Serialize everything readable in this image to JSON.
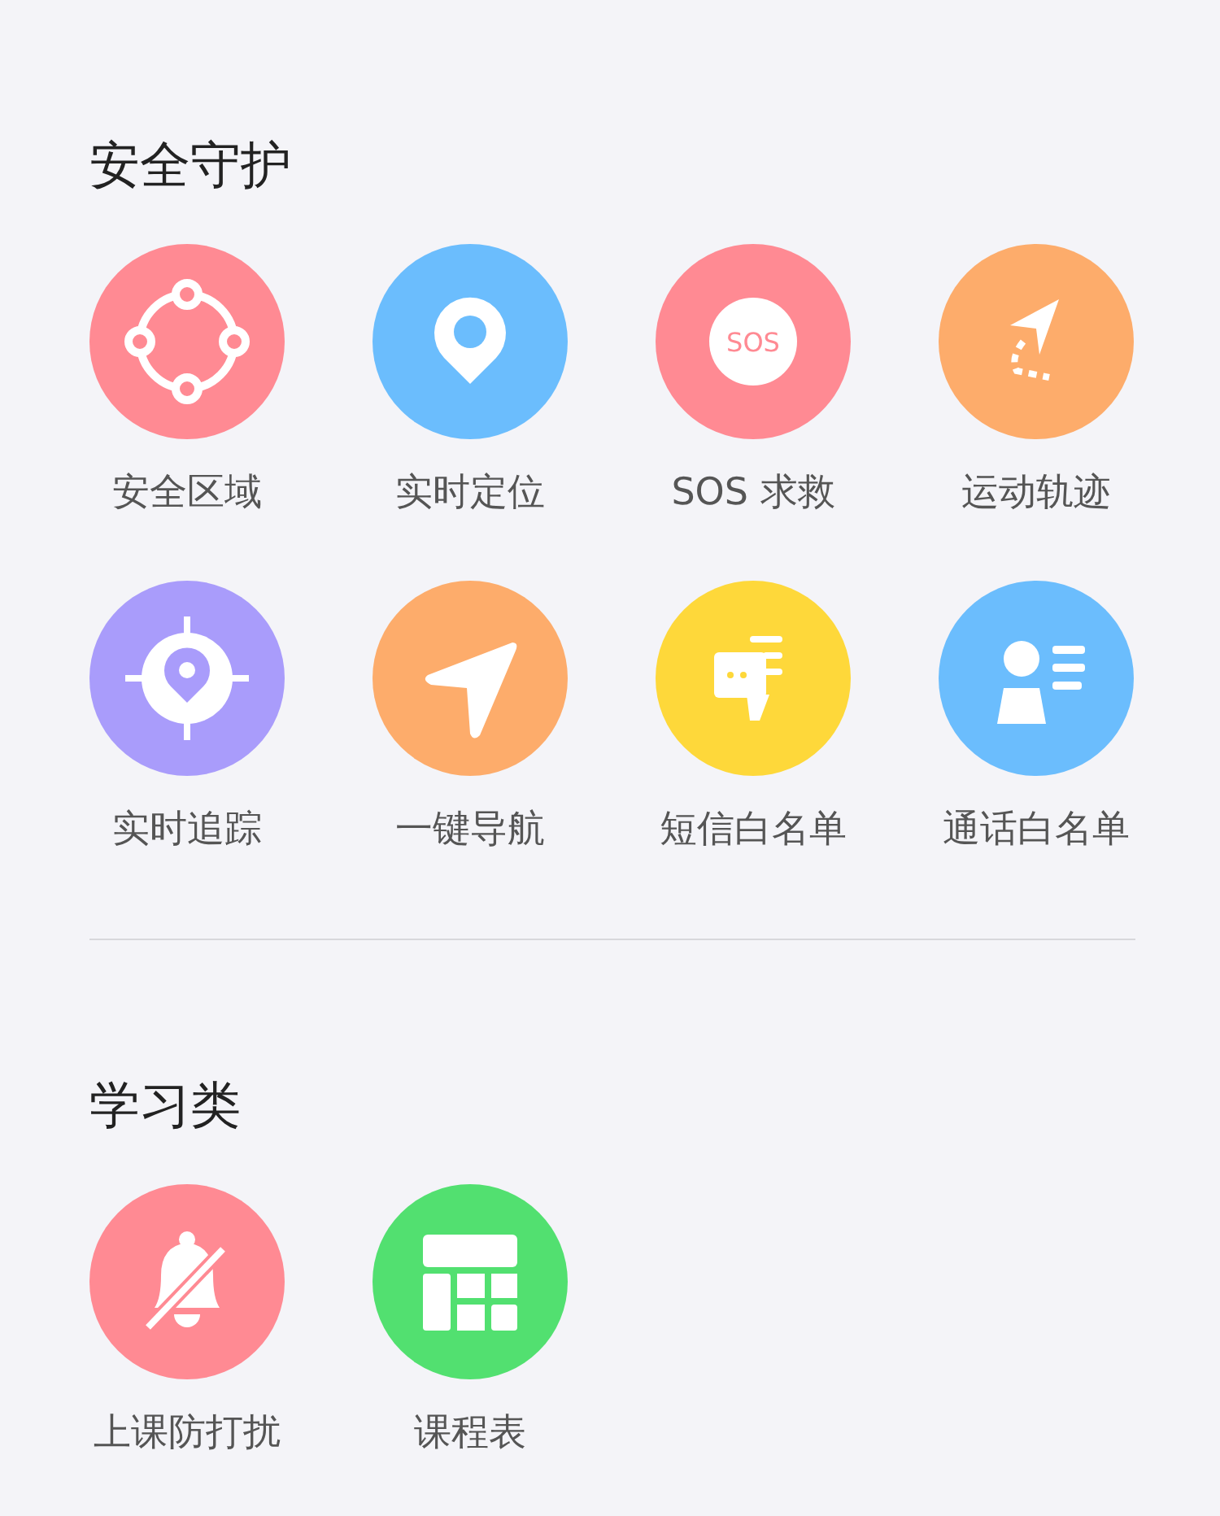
{
  "sections": [
    {
      "title": "安全守护",
      "items": [
        {
          "label": "安全区域",
          "kind": "zone",
          "color": "#ff8a93"
        },
        {
          "label": "实时定位",
          "kind": "pin",
          "color": "#6bbdfd"
        },
        {
          "label": "SOS 求救",
          "kind": "sos",
          "color": "#ff8a93",
          "badge_text": "SOS"
        },
        {
          "label": "运动轨迹",
          "kind": "track",
          "color": "#fdac6b"
        },
        {
          "label": "实时追踪",
          "kind": "target",
          "color": "#a99cfb"
        },
        {
          "label": "一键导航",
          "kind": "nav",
          "color": "#fdac6b"
        },
        {
          "label": "短信白名单",
          "kind": "sms",
          "color": "#fed83a"
        },
        {
          "label": "通话白名单",
          "kind": "contact",
          "color": "#6bbdfd"
        }
      ]
    },
    {
      "title": "学习类",
      "items": [
        {
          "label": "上课防打扰",
          "kind": "mute",
          "color": "#ff8a93"
        },
        {
          "label": "课程表",
          "kind": "table",
          "color": "#52e070"
        }
      ]
    }
  ]
}
